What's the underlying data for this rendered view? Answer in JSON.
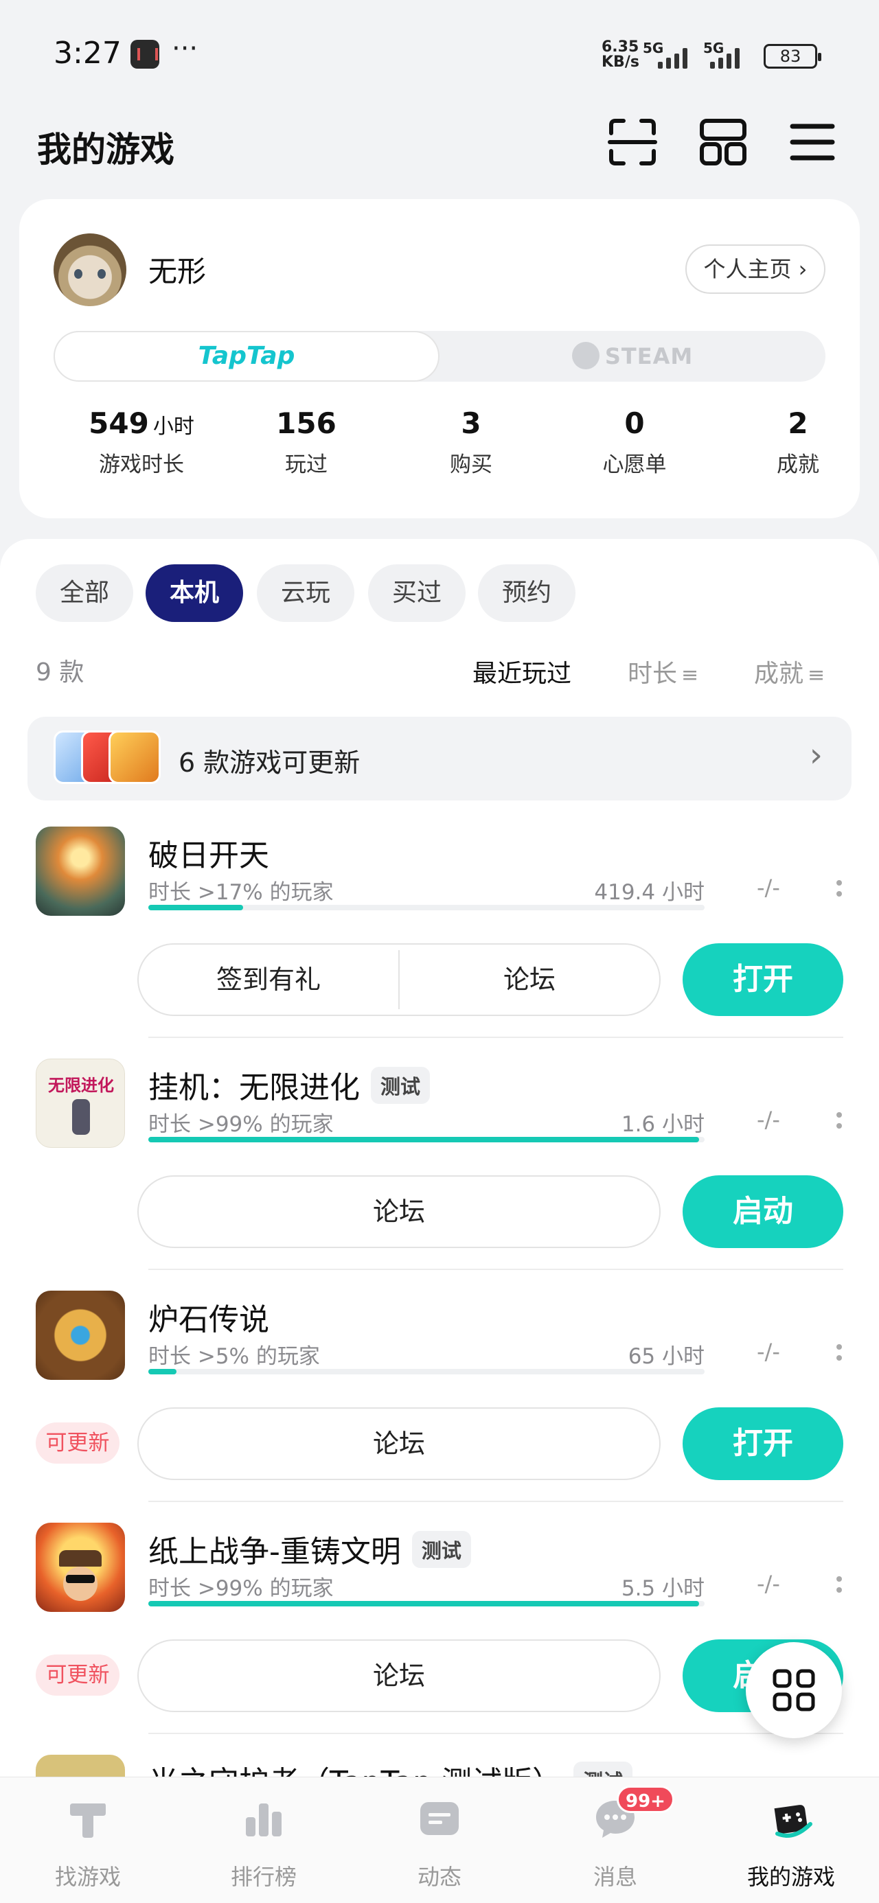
{
  "status_bar": {
    "time": "3:27",
    "dots": "···",
    "net_speed_top": "6.35",
    "net_speed_bottom": "KB/s",
    "sim1": "5G",
    "sim2": "5G",
    "battery": "83"
  },
  "header": {
    "title": "我的游戏"
  },
  "profile": {
    "name": "无形",
    "homepage_label": "个人主页 ›",
    "tabs": {
      "taptap": "TapTap",
      "steam": "STEAM"
    },
    "stats": [
      {
        "value": "549",
        "unit": "小时",
        "label": "游戏时长"
      },
      {
        "value": "156",
        "unit": "",
        "label": "玩过"
      },
      {
        "value": "3",
        "unit": "",
        "label": "购买"
      },
      {
        "value": "0",
        "unit": "",
        "label": "心愿单"
      },
      {
        "value": "2",
        "unit": "",
        "label": "成就"
      }
    ]
  },
  "filters": [
    "全部",
    "本机",
    "云玩",
    "买过",
    "预约"
  ],
  "active_filter": "本机",
  "list": {
    "count": "9 款",
    "sort": {
      "recent": "最近玩过",
      "duration": "时长",
      "achievement": "成就"
    },
    "update_banner": "6 款游戏可更新"
  },
  "games": [
    {
      "title": "破日开天",
      "tag": "",
      "meta": "时长 >17% 的玩家",
      "hours": "419.4 小时",
      "progress": 0.17,
      "score": "-/-",
      "pills": [
        "签到有礼",
        "论坛"
      ],
      "action": "打开",
      "update": ""
    },
    {
      "title": "挂机：无限进化",
      "tag": "测试",
      "meta": "时长 >99% 的玩家",
      "hours": "1.6 小时",
      "progress": 0.99,
      "score": "-/-",
      "pills": [
        "论坛"
      ],
      "action": "启动",
      "update": "",
      "icon_text": "无限进化"
    },
    {
      "title": "炉石传说",
      "tag": "",
      "meta": "时长 >5% 的玩家",
      "hours": "65 小时",
      "progress": 0.05,
      "score": "-/-",
      "pills": [
        "论坛"
      ],
      "action": "打开",
      "update": "可更新"
    },
    {
      "title": "纸上战争-重铸文明",
      "tag": "测试",
      "meta": "时长 >99% 的玩家",
      "hours": "5.5 小时",
      "progress": 0.99,
      "score": "-/-",
      "pills": [
        "论坛"
      ],
      "action": "启动",
      "update": "可更新"
    },
    {
      "title": "光之守护者（TapTap 测试版）",
      "tag": "测试"
    }
  ],
  "bottom_nav": [
    {
      "label": "找游戏"
    },
    {
      "label": "排行榜"
    },
    {
      "label": "动态"
    },
    {
      "label": "消息",
      "badge": "99+"
    },
    {
      "label": "我的游戏"
    }
  ],
  "colors": {
    "accent": "#16d2be",
    "chip_active": "#1a1f7a",
    "update_red": "#f0525f"
  }
}
